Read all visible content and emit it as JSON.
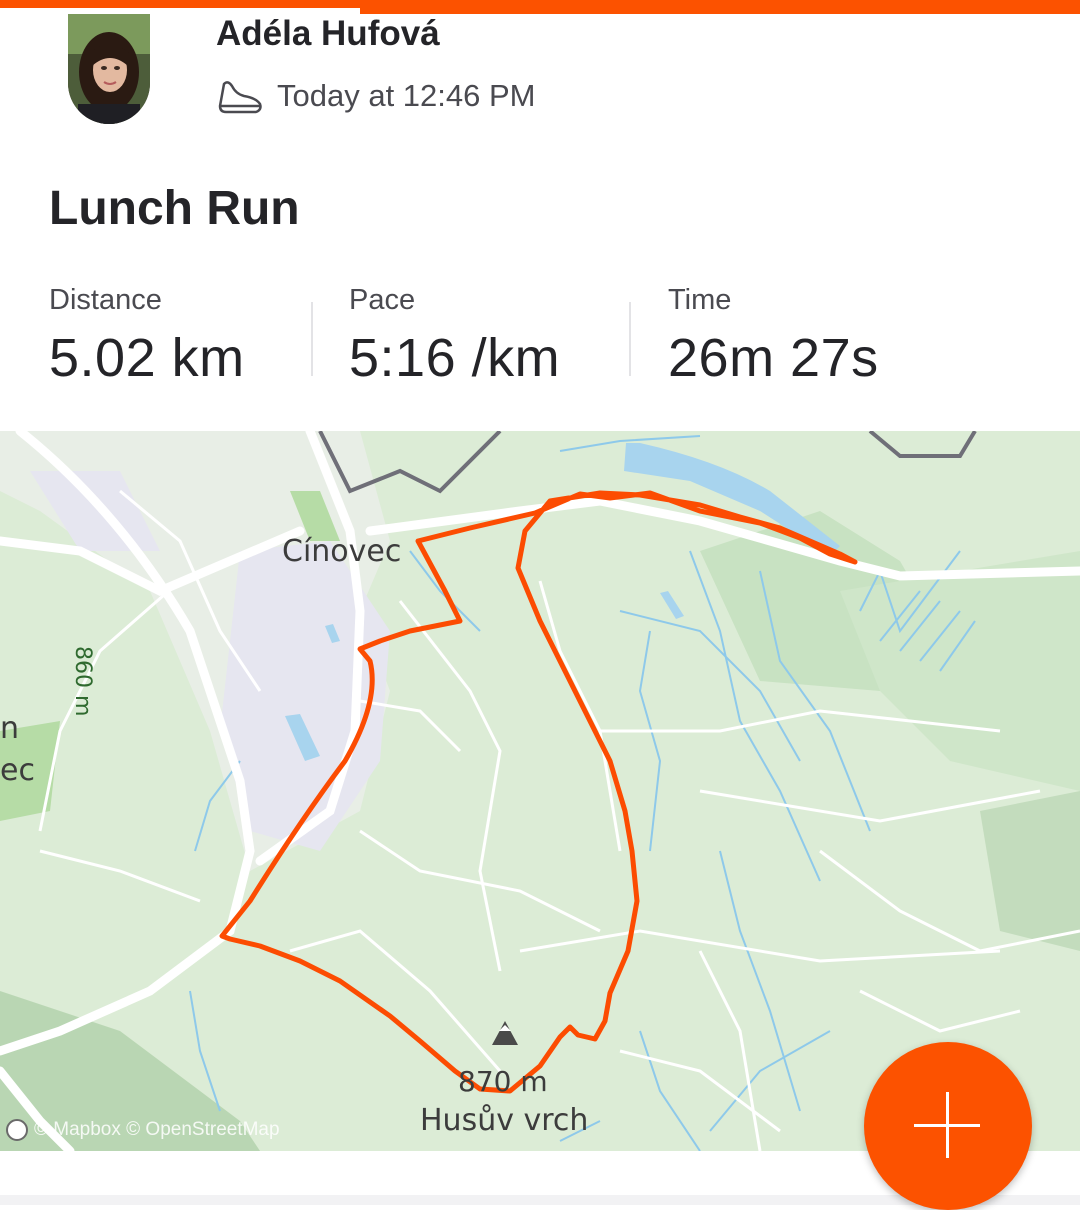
{
  "activity": {
    "athlete_name": "Adéla Hufová",
    "timestamp": "Today at 12:46 PM",
    "sport_icon": "running-shoe-icon",
    "title": "Lunch Run"
  },
  "stats": [
    {
      "label": "Distance",
      "value": "5.02 km"
    },
    {
      "label": "Pace",
      "value": "5:16 /km"
    },
    {
      "label": "Time",
      "value": "26m 27s"
    }
  ],
  "map": {
    "labels": {
      "cinovec": "Cínovec",
      "husuv_vrch": "Husův vrch",
      "peak_elevation": "870 m",
      "elevation_860": "860 m",
      "edge_n": "n",
      "edge_ec": "ec"
    },
    "attribution": "© Mapbox © OpenStreetMap",
    "route_color": "#fc4c02"
  },
  "fab": {
    "icon": "plus-icon"
  },
  "colors": {
    "brand": "#fc5200",
    "map_land": "#d9ebd4",
    "water": "#a7d3ee"
  }
}
